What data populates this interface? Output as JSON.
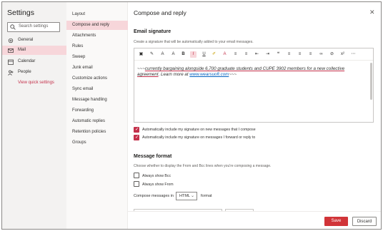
{
  "left": {
    "title": "Settings",
    "search_placeholder": "Search settings",
    "items": [
      {
        "label": "General",
        "icon": "gear-icon"
      },
      {
        "label": "Mail",
        "icon": "mail-icon"
      },
      {
        "label": "Calendar",
        "icon": "calendar-icon"
      },
      {
        "label": "People",
        "icon": "people-icon"
      }
    ],
    "quick_link": "View quick settings"
  },
  "middle": {
    "items": [
      "Layout",
      "Compose and reply",
      "Attachments",
      "Rules",
      "Sweep",
      "Junk email",
      "Customize actions",
      "Sync email",
      "Message handling",
      "Forwarding",
      "Automatic replies",
      "Retention policies",
      "Groups"
    ]
  },
  "panel": {
    "title": "Compose and reply",
    "close_icon": "close-icon",
    "signature": {
      "heading": "Email signature",
      "description": "Create a signature that will be automatically added to your email messages.",
      "text_prefix": "~~~",
      "text_underlined": "currently bargaining alongside 6,700 graduate students and CUPE 3902 members for a new collective agreement",
      "text_mid": ". Learn more at ",
      "link": "www.wearsuoft.com",
      "text_suffix": "~~~",
      "checkbox_new": "Automatically include my signature on new messages that I compose",
      "checkbox_forward": "Automatically include my signature on messages I forward or reply to"
    },
    "format": {
      "heading": "Message format",
      "description": "Choose whether to display the From and Bcc lines when you're composing a message.",
      "bcc": "Always show Bcc",
      "from": "Always show From",
      "compose_label": "Compose messages in",
      "compose_value": "HTML",
      "format_label": "format"
    },
    "save": "Save",
    "discard": "Discard"
  },
  "colors": {
    "accent": "#c4314b",
    "selected_bg": "#f7d6da",
    "save_bg": "#d13438"
  }
}
